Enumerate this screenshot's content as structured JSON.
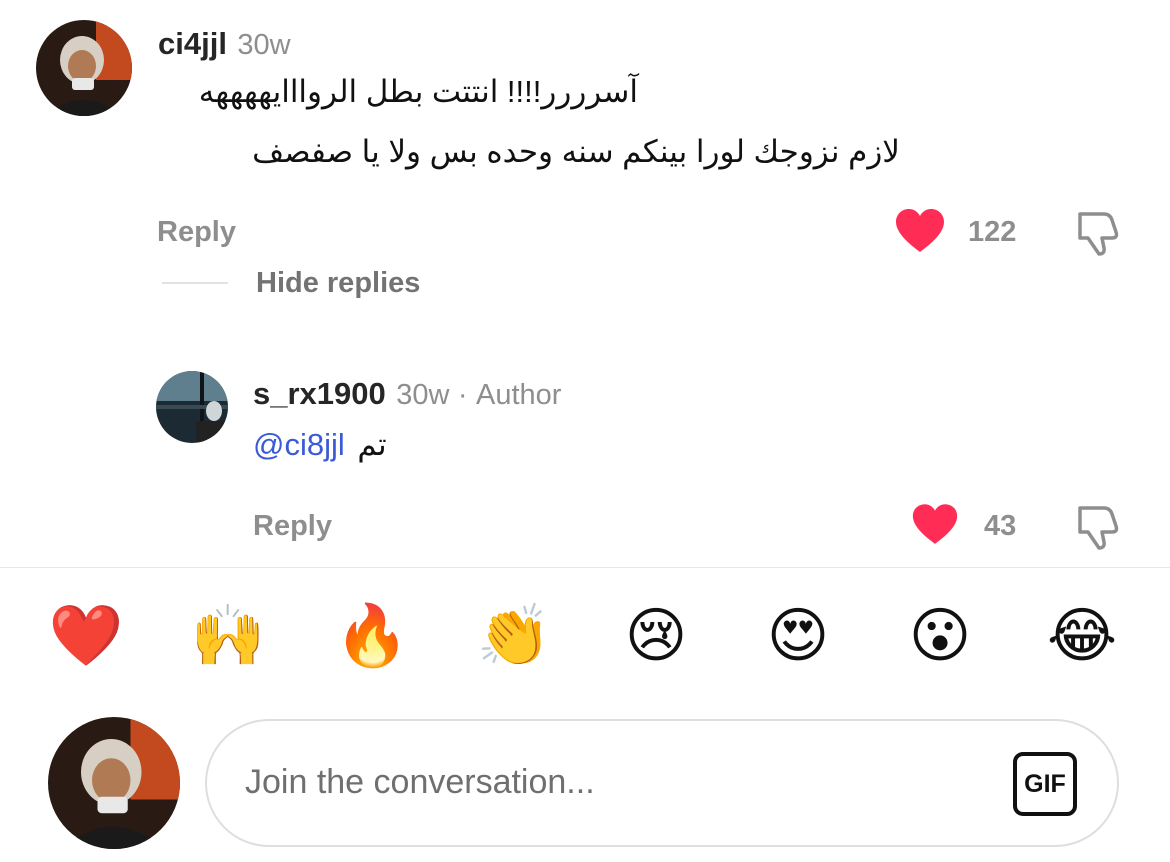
{
  "comment": {
    "username": "ci4jjl",
    "time": "30w",
    "line1": "آسرررر!!!! انتتت بطل الروااايههههه",
    "line2": "لازم نزوجك لورا بينكم سنه وحده بس ولا يا صفصف",
    "reply_label": "Reply",
    "like_count": "122",
    "hide_replies_label": "Hide replies"
  },
  "reply": {
    "username": "s_rx1900",
    "time": "30w",
    "separator": "·",
    "author_tag": "Author",
    "mention": "@ci8jjl",
    "text": "تم",
    "reply_label": "Reply",
    "like_count": "43"
  },
  "reactions": [
    {
      "icon": "red-heart",
      "glyph": "❤️"
    },
    {
      "icon": "raising-hands",
      "glyph": "🙌"
    },
    {
      "icon": "fire",
      "glyph": "🔥"
    },
    {
      "icon": "clapping-hands",
      "glyph": "👏"
    },
    {
      "icon": "crying-face",
      "glyph": "😢"
    },
    {
      "icon": "heart-eyes-face",
      "glyph": "😍"
    },
    {
      "icon": "surprised-face",
      "glyph": "😮"
    },
    {
      "icon": "tears-of-joy-face",
      "glyph": "😂"
    }
  ],
  "composer": {
    "placeholder": "Join the conversation...",
    "gif_label": "GIF"
  },
  "colors": {
    "like_red": "#ff2d55",
    "mention_blue": "#3b5bd6",
    "muted_gray": "#8e8e8e"
  }
}
